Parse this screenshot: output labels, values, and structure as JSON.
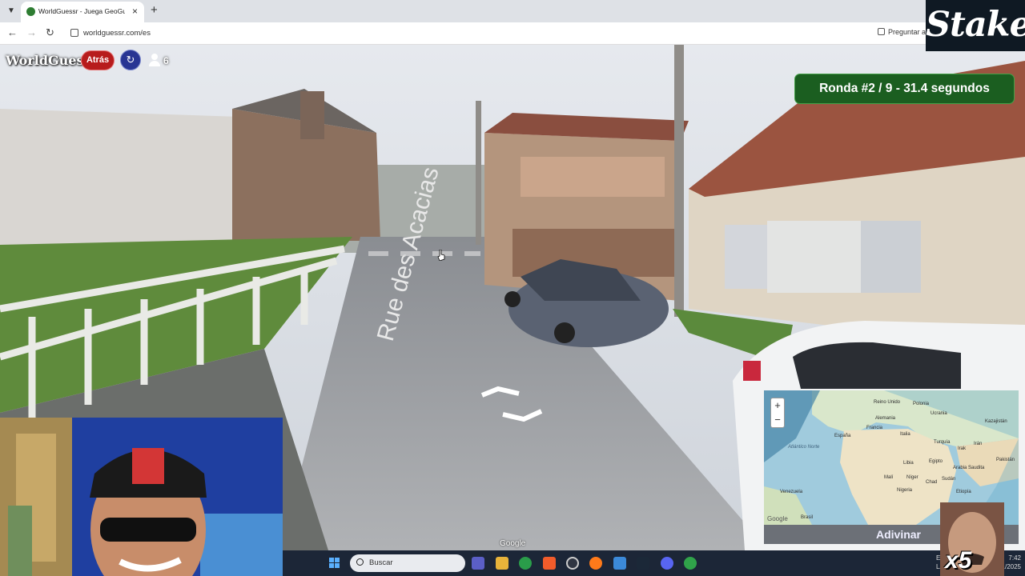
{
  "browser": {
    "tab_title": "WorldGuessr - Juega GeoGuessr",
    "new_tab_symbol": "+",
    "close_symbol": "×",
    "url": "worldguessr.com/es",
    "ask_label": "Preguntar a"
  },
  "game": {
    "brand": "WorldGuessr",
    "back_label": "Atrás",
    "refresh_symbol": "↻",
    "player_count": "6",
    "round_text": "Ronda #2 / 9 - 31.4 segundos",
    "street_name": "Rue des Acacias",
    "google_watermark": "Google"
  },
  "minimap": {
    "zoom_in": "+",
    "zoom_out": "−",
    "labels": [
      "Reino Unido",
      "Polonia",
      "Alemania",
      "Ucrania",
      "Kazajistán",
      "Francia",
      "Italia",
      "España",
      "Turquía",
      "Irak",
      "Irán",
      "Pakistán",
      "Atlántico Norte",
      "Libia",
      "Egipto",
      "Arabia Saudita",
      "Malí",
      "Níger",
      "Chad",
      "Sudán",
      "Nigeria",
      "Etiopía",
      "Venezuela",
      "Brasil"
    ],
    "google_label": "Google",
    "guess_label": "Adivinar"
  },
  "overlay": {
    "stake_logo": "Stake",
    "multiplier": "x5"
  },
  "taskbar": {
    "search_placeholder": "Buscar",
    "lang": "ESP",
    "lang2": "LAA",
    "time": "7:42",
    "date": "11/2025"
  }
}
